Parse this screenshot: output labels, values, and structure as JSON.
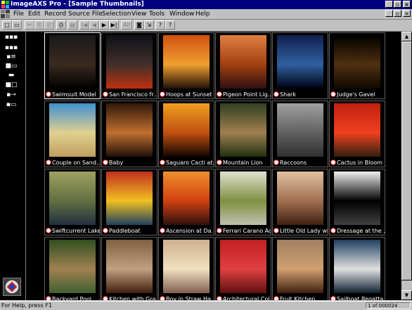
{
  "window": {
    "title": "ImageAXS Pro - [Sample Thumbnails]",
    "minimize": "_",
    "restore": "▫",
    "close": "×"
  },
  "menu": {
    "items": [
      "File",
      "Edit",
      "Record",
      "Source File",
      "Selection",
      "View",
      "Tools",
      "Window",
      "Help"
    ]
  },
  "toolbar": {
    "buttons": [
      "new",
      "open",
      "cut",
      "copy",
      "paste",
      "print",
      "save",
      "first-record",
      "previous-record",
      "next-record",
      "last-record",
      "all",
      "camera",
      "import",
      "help",
      "context-help"
    ],
    "labels": [
      "□",
      "▭",
      "✂",
      "⎘",
      "⎗",
      "⎙",
      "▤",
      "|◀",
      "◀",
      "▶",
      "▶|",
      "All",
      "◙",
      "⇲",
      "?",
      "?"
    ]
  },
  "sidebar": {
    "view_buttons": [
      "▪▪▪",
      "▪▪▪",
      "▪≡",
      "■▭",
      "▬",
      "■□",
      "▪⊸",
      "▪▭"
    ]
  },
  "thumbnails": [
    {
      "caption": "Swimsuit Model",
      "colors": [
        "#1a1a1a",
        "#3a2a20",
        "#000000"
      ],
      "selected": true
    },
    {
      "caption": "San Francisco fr...",
      "colors": [
        "#101018",
        "#40302a",
        "#c03010"
      ]
    },
    {
      "caption": "Hoops at Sunset",
      "colors": [
        "#d05010",
        "#f0a030",
        "#201008"
      ]
    },
    {
      "caption": "Pigeon Point Lig...",
      "colors": [
        "#e08040",
        "#a04010",
        "#301010"
      ]
    },
    {
      "caption": "Shark",
      "colors": [
        "#102050",
        "#3060a0",
        "#000010"
      ]
    },
    {
      "caption": "Judge's Gavel",
      "colors": [
        "#000000",
        "#503010",
        "#100800"
      ]
    },
    {
      "caption": "Couple on Sand...",
      "colors": [
        "#4090d0",
        "#e0d090",
        "#c0a060"
      ]
    },
    {
      "caption": "Baby",
      "colors": [
        "#301808",
        "#c07030",
        "#201008"
      ]
    },
    {
      "caption": "Saguaro Cacti at...",
      "colors": [
        "#f0a020",
        "#c05010",
        "#100500"
      ]
    },
    {
      "caption": "Mountain Lion",
      "colors": [
        "#304020",
        "#a08050",
        "#203010"
      ]
    },
    {
      "caption": "Raccoons",
      "colors": [
        "#a0a0a0",
        "#606060",
        "#303030"
      ]
    },
    {
      "caption": "Cactus in Bloom",
      "colors": [
        "#c02010",
        "#f04020",
        "#302010"
      ]
    },
    {
      "caption": "Swiftcurrent Lake",
      "colors": [
        "#a0a060",
        "#607040",
        "#203040"
      ]
    },
    {
      "caption": "Paddleboat",
      "colors": [
        "#c03020",
        "#f0c020",
        "#204060"
      ]
    },
    {
      "caption": "Ascension at Da...",
      "colors": [
        "#f09030",
        "#d04010",
        "#301010"
      ]
    },
    {
      "caption": "Ferrari Carano Ad",
      "colors": [
        "#e0e0d0",
        "#809040",
        "#c0c0b0"
      ]
    },
    {
      "caption": "Little Old Lady wi...",
      "colors": [
        "#e0c0a0",
        "#a07050",
        "#402010"
      ]
    },
    {
      "caption": "Dressage at the ...",
      "colors": [
        "#f0f0f0",
        "#000000",
        "#404040"
      ]
    },
    {
      "caption": "Backyard Pool",
      "colors": [
        "#305020",
        "#a08050",
        "#406030"
      ]
    },
    {
      "caption": "Kitchen with Gra...",
      "colors": [
        "#806040",
        "#c0a080",
        "#402010"
      ]
    },
    {
      "caption": "Boy in Straw Ha...",
      "colors": [
        "#d0b090",
        "#f0e0c0",
        "#806050"
      ]
    },
    {
      "caption": "Architectural Col...",
      "colors": [
        "#c02020",
        "#e04040",
        "#601010"
      ]
    },
    {
      "caption": "Fruit Kitchen...",
      "colors": [
        "#a08060",
        "#d0a070",
        "#402010"
      ]
    },
    {
      "caption": "Sailboat Regatta...",
      "colors": [
        "#204060",
        "#e0e0e0",
        "#102030"
      ]
    }
  ],
  "status": {
    "help": "For Help, press F1",
    "record": "1 of 000024"
  }
}
